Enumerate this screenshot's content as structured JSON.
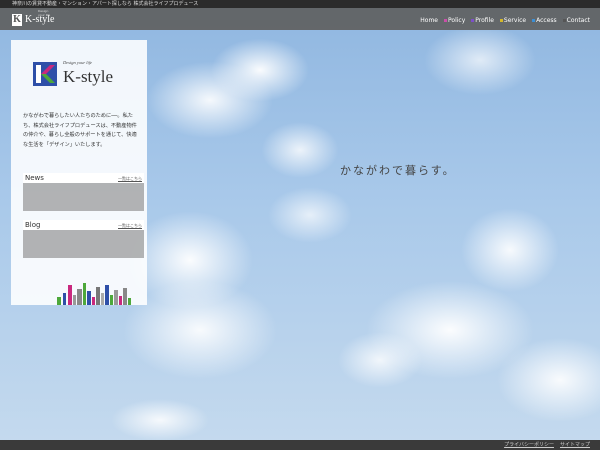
{
  "topbar": {
    "text": "神奈川の賃貸不動産・マンション・アパート探しなら 株式会社ライフプロデュース"
  },
  "header": {
    "logo_letter": "K",
    "logo_text": "K-style",
    "logo_tag": "Design your life",
    "nav": [
      {
        "label": "Home",
        "color": ""
      },
      {
        "label": "Policy",
        "color": "#c94fa8"
      },
      {
        "label": "Profile",
        "color": "#7d4fc9"
      },
      {
        "label": "Service",
        "color": "#d4b82a"
      },
      {
        "label": "Access",
        "color": "#3b8ed4"
      },
      {
        "label": "Contact",
        "color": "#555555"
      }
    ]
  },
  "panel": {
    "tagline": "Design your life",
    "brand": "K-style",
    "intro": "かながわで暮らしたい人たちのために──。私たち、株式会社ライフプロデュースは、不動産物件の仲介や、暮らし全般のサポートを通じて、快適な生活を「デザイン」いたします。",
    "news": {
      "title": "News",
      "more": "一覧はこちら",
      "items": [
        {
          "date": "",
          "text": ""
        },
        {
          "date": "",
          "text": ""
        },
        {
          "date": "",
          "text": ""
        }
      ]
    },
    "blog": {
      "title": "Blog",
      "more": "一覧はこちら",
      "items": [
        {
          "date": "",
          "text": ""
        },
        {
          "date": "",
          "text": ""
        },
        {
          "date": "",
          "text": ""
        }
      ]
    }
  },
  "main": {
    "catch": "かながわで暮らす。",
    "credit": ""
  },
  "footer": {
    "copyright": "",
    "links": [
      "プライバシーポリシー",
      "サイトマップ"
    ]
  },
  "colors": {
    "accent_magenta": "#c9287e",
    "accent_blue": "#2e4fa8",
    "accent_green": "#4da83b"
  }
}
